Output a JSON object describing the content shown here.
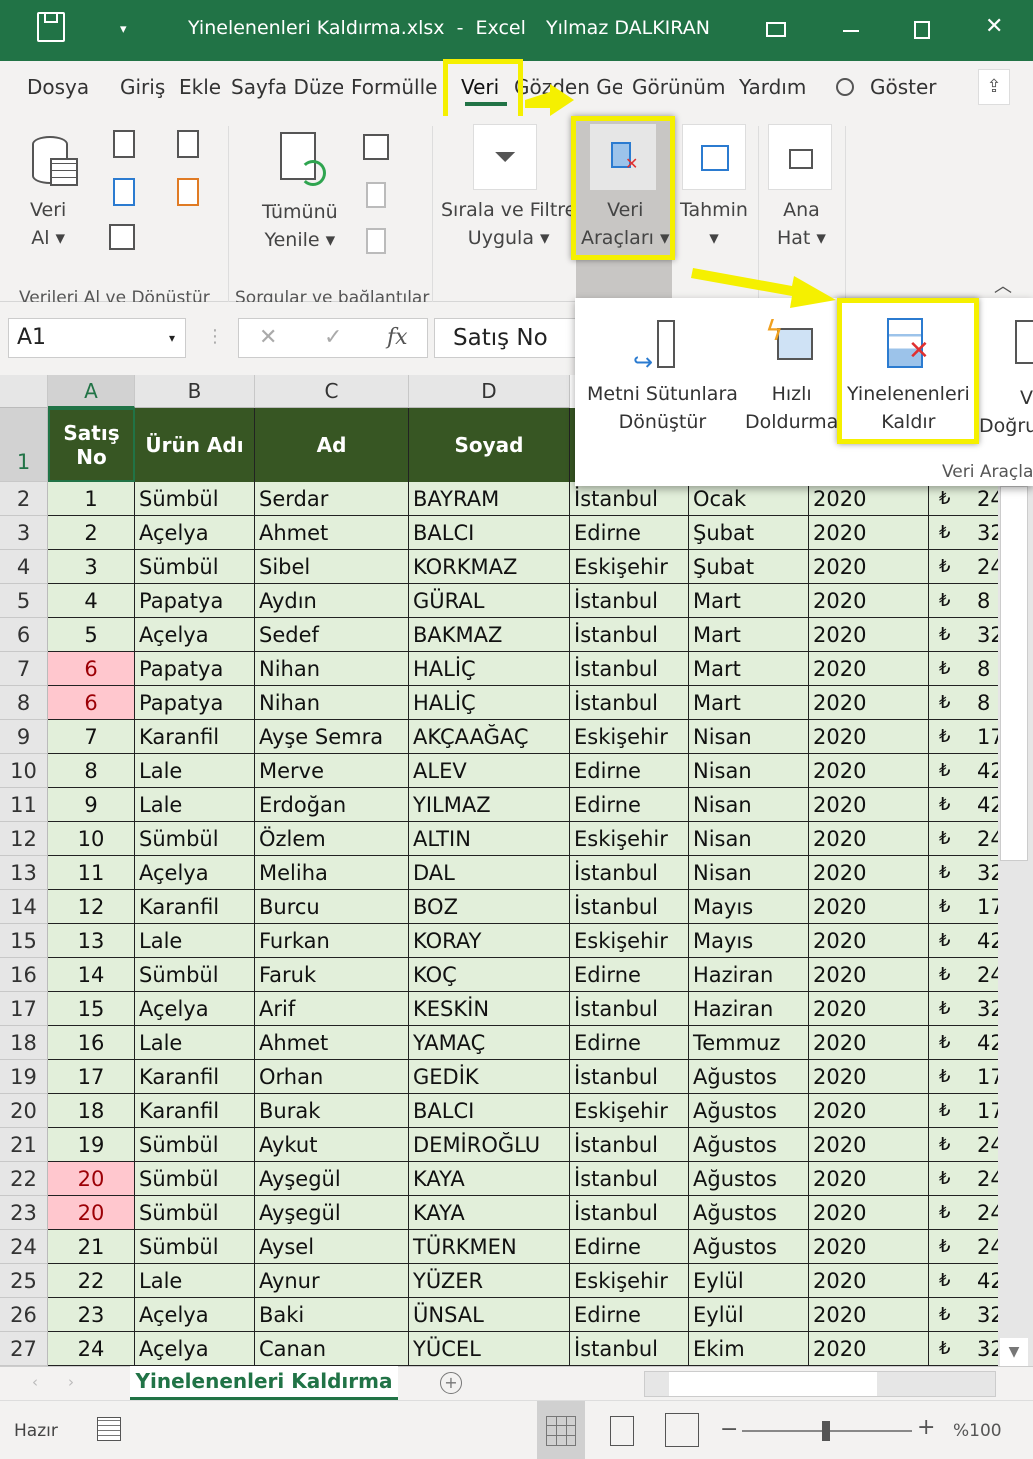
{
  "titlebar": {
    "filename": "Yinelenenleri Kaldırma.xlsx",
    "app": "Excel",
    "separator": "-",
    "user": "Yılmaz DALKIRAN"
  },
  "tabs": [
    "Dosya",
    "Giriş",
    "Ekle",
    "Sayfa Düze",
    "Formülle",
    "Veri",
    "Gözden Ge",
    "Görünüm",
    "Yardım"
  ],
  "tell_me": "Göster",
  "ribbon": {
    "get_data": [
      "Veri",
      "Al ▾"
    ],
    "refresh_all": [
      "Tümünü",
      "Yenile ▾"
    ],
    "sort_filter": [
      "Sırala ve Filtre",
      "Uygula ▾"
    ],
    "data_tools": [
      "Veri",
      "Araçları ▾"
    ],
    "forecast": [
      "Tahmin",
      "▾"
    ],
    "outline": [
      "Ana",
      "Hat ▾"
    ],
    "groups": [
      "Verileri Al ve Dönüştür",
      "Sorgular ve bağlantılar"
    ]
  },
  "popup": {
    "text_to_columns": [
      "Metni Sütunlara",
      "Dönüştür"
    ],
    "flash_fill": [
      "Hızlı",
      "Doldurma"
    ],
    "remove_duplicates": [
      "Yinelenenleri",
      "Kaldır"
    ],
    "validation": [
      "V",
      "Doğru"
    ],
    "group": "Veri Araçla"
  },
  "formula_bar": {
    "name_box": "A1",
    "content": "Satış No",
    "fx": "fx"
  },
  "columns": [
    "A",
    "B",
    "C",
    "D"
  ],
  "headers": [
    "Satış No",
    "Ürün Adı",
    "Ad",
    "Soyad"
  ],
  "rows": [
    [
      "2",
      "1",
      "Sümbül",
      "Serdar",
      "BAYRAM",
      "İstanbul",
      "Ocak",
      "2020",
      "₺",
      "24"
    ],
    [
      "3",
      "2",
      "Açelya",
      "Ahmet",
      "BALCI",
      "Edirne",
      "Şubat",
      "2020",
      "₺",
      "32"
    ],
    [
      "4",
      "3",
      "Sümbül",
      "Sibel",
      "KORKMAZ",
      "Eskişehir",
      "Şubat",
      "2020",
      "₺",
      "24"
    ],
    [
      "5",
      "4",
      "Papatya",
      "Aydın",
      "GÜRAL",
      "İstanbul",
      "Mart",
      "2020",
      "₺",
      "8"
    ],
    [
      "6",
      "5",
      "Açelya",
      "Sedef",
      "BAKMAZ",
      "İstanbul",
      "Mart",
      "2020",
      "₺",
      "32"
    ],
    [
      "7",
      "6",
      "Papatya",
      "Nihan",
      "HALİÇ",
      "İstanbul",
      "Mart",
      "2020",
      "₺",
      "8"
    ],
    [
      "8",
      "6",
      "Papatya",
      "Nihan",
      "HALİÇ",
      "İstanbul",
      "Mart",
      "2020",
      "₺",
      "8"
    ],
    [
      "9",
      "7",
      "Karanfil",
      "Ayşe Semra",
      "AKÇAAĞAÇ",
      "Eskişehir",
      "Nisan",
      "2020",
      "₺",
      "17"
    ],
    [
      "10",
      "8",
      "Lale",
      "Merve",
      "ALEV",
      "Edirne",
      "Nisan",
      "2020",
      "₺",
      "42"
    ],
    [
      "11",
      "9",
      "Lale",
      "Erdoğan",
      "YILMAZ",
      "Edirne",
      "Nisan",
      "2020",
      "₺",
      "42"
    ],
    [
      "12",
      "10",
      "Sümbül",
      "Özlem",
      "ALTIN",
      "Eskişehir",
      "Nisan",
      "2020",
      "₺",
      "24"
    ],
    [
      "13",
      "11",
      "Açelya",
      "Meliha",
      "DAL",
      "İstanbul",
      "Nisan",
      "2020",
      "₺",
      "32"
    ],
    [
      "14",
      "12",
      "Karanfil",
      "Burcu",
      "BOZ",
      "İstanbul",
      "Mayıs",
      "2020",
      "₺",
      "17"
    ],
    [
      "15",
      "13",
      "Lale",
      "Furkan",
      "KORAY",
      "Eskişehir",
      "Mayıs",
      "2020",
      "₺",
      "42"
    ],
    [
      "16",
      "14",
      "Sümbül",
      "Faruk",
      "KOÇ",
      "Edirne",
      "Haziran",
      "2020",
      "₺",
      "24"
    ],
    [
      "17",
      "15",
      "Açelya",
      "Arif",
      "KESKİN",
      "İstanbul",
      "Haziran",
      "2020",
      "₺",
      "32"
    ],
    [
      "18",
      "16",
      "Lale",
      "Ahmet",
      "YAMAÇ",
      "Edirne",
      "Temmuz",
      "2020",
      "₺",
      "42"
    ],
    [
      "19",
      "17",
      "Karanfil",
      "Orhan",
      "GEDİK",
      "İstanbul",
      "Ağustos",
      "2020",
      "₺",
      "17"
    ],
    [
      "20",
      "18",
      "Karanfil",
      "Burak",
      "BALCI",
      "Eskişehir",
      "Ağustos",
      "2020",
      "₺",
      "17"
    ],
    [
      "21",
      "19",
      "Sümbül",
      "Aykut",
      "DEMİROĞLU",
      "İstanbul",
      "Ağustos",
      "2020",
      "₺",
      "24"
    ],
    [
      "22",
      "20",
      "Sümbül",
      "Ayşegül",
      "KAYA",
      "İstanbul",
      "Ağustos",
      "2020",
      "₺",
      "24"
    ],
    [
      "23",
      "20",
      "Sümbül",
      "Ayşegül",
      "KAYA",
      "İstanbul",
      "Ağustos",
      "2020",
      "₺",
      "24"
    ],
    [
      "24",
      "21",
      "Sümbül",
      "Aysel",
      "TÜRKMEN",
      "Edirne",
      "Ağustos",
      "2020",
      "₺",
      "24"
    ],
    [
      "25",
      "22",
      "Lale",
      "Aynur",
      "YÜZER",
      "Eskişehir",
      "Eylül",
      "2020",
      "₺",
      "42"
    ],
    [
      "26",
      "23",
      "Açelya",
      "Baki",
      "ÜNSAL",
      "Edirne",
      "Eylül",
      "2020",
      "₺",
      "32"
    ],
    [
      "27",
      "24",
      "Açelya",
      "Canan",
      "YÜCEL",
      "İstanbul",
      "Ekim",
      "2020",
      "₺",
      "32"
    ]
  ],
  "duplicate_rows": [
    "7",
    "8",
    "22",
    "23"
  ],
  "colors": {
    "title_green": "#217346",
    "header_green": "#375623",
    "cell_green": "#e2efda",
    "dup_fill": "#ffc7ce",
    "dup_text": "#9c0006",
    "highlight": "#f5f000"
  },
  "sheet_tab": "Yinelenenleri Kaldırma",
  "status": {
    "ready": "Hazır",
    "zoom": "%100",
    "zoom_level": 100
  }
}
